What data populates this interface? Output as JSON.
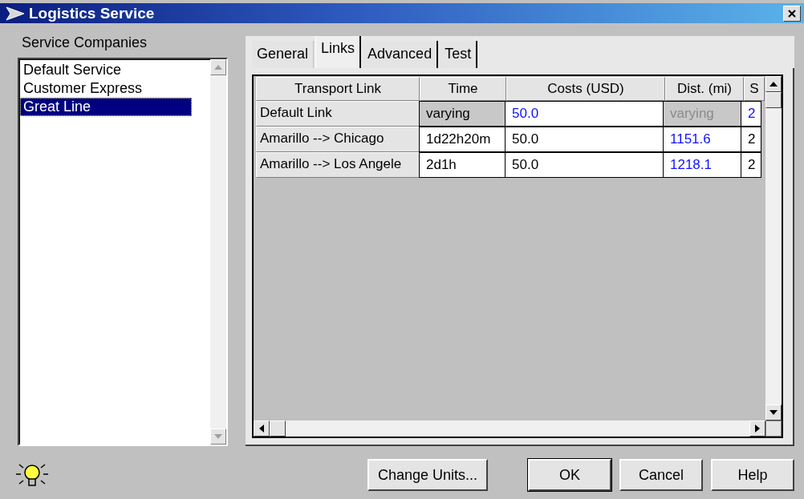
{
  "window": {
    "title": "Logistics Service"
  },
  "companies": {
    "label": "Service Companies",
    "items": [
      {
        "label": "Default Service",
        "selected": false
      },
      {
        "label": "Customer Express",
        "selected": false
      },
      {
        "label": "Great Line",
        "selected": true
      }
    ]
  },
  "tabs": [
    {
      "label": "General",
      "selected": false
    },
    {
      "label": "Links",
      "selected": true
    },
    {
      "label": "Advanced",
      "selected": false
    },
    {
      "label": "Test",
      "selected": false
    }
  ],
  "table": {
    "columns": [
      "Transport Link",
      "Time",
      "Costs (USD)",
      "Dist. (mi)",
      "S"
    ],
    "rows": [
      {
        "cells": [
          {
            "text": "Default Link",
            "kind": "row-header"
          },
          {
            "text": "varying",
            "kind": "varying"
          },
          {
            "text": "50.0",
            "kind": "override"
          },
          {
            "text": "varying",
            "kind": "varying-dim"
          },
          {
            "text": "2",
            "kind": "override"
          }
        ]
      },
      {
        "cells": [
          {
            "text": "Amarillo --> Chicago",
            "kind": "row-header"
          },
          {
            "text": "1d22h20m",
            "kind": "plain"
          },
          {
            "text": "50.0",
            "kind": "plain"
          },
          {
            "text": "1151.6",
            "kind": "override"
          },
          {
            "text": "2",
            "kind": "plain"
          }
        ]
      },
      {
        "cells": [
          {
            "text": "Amarillo --> Los Angele",
            "kind": "row-header"
          },
          {
            "text": "2d1h",
            "kind": "plain"
          },
          {
            "text": "50.0",
            "kind": "plain"
          },
          {
            "text": "1218.1",
            "kind": "override"
          },
          {
            "text": "2",
            "kind": "plain"
          }
        ]
      }
    ]
  },
  "buttons": [
    {
      "label": "Change Units...",
      "kind": "secondary"
    },
    {
      "label": "OK",
      "kind": "default"
    },
    {
      "label": "Cancel",
      "kind": "normal"
    },
    {
      "label": "Help",
      "kind": "normal"
    }
  ]
}
